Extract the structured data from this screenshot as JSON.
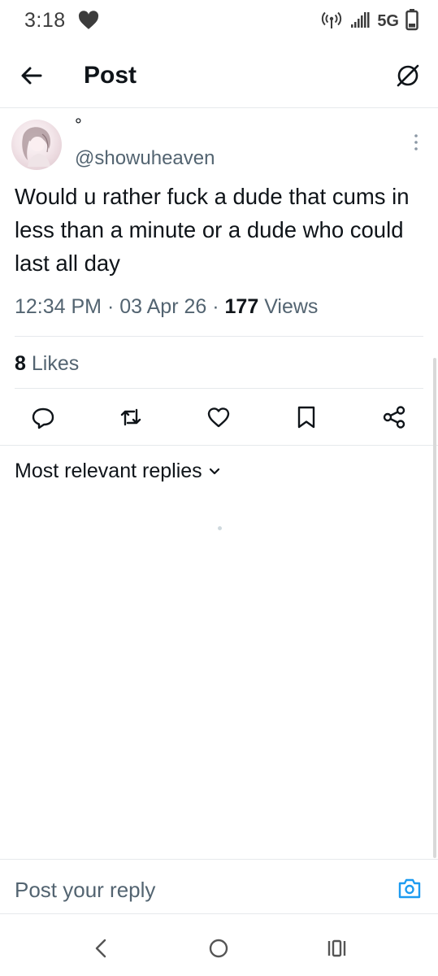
{
  "status_bar": {
    "time": "3:18",
    "network": "5G",
    "icons": [
      "heart-icon",
      "hotspot-icon",
      "signal-icon",
      "battery-icon"
    ]
  },
  "header": {
    "title": "Post",
    "back_icon": "arrow-left-icon",
    "grok_icon": "grok-icon"
  },
  "post": {
    "display_name": "°",
    "handle": "@showuheaven",
    "text": "Would u rather fuck a dude that cums in less than a minute or a dude who could last all day",
    "time": "12:34 PM",
    "date": "03 Apr 26",
    "separator": "·",
    "views_count": "177",
    "views_label": "Views",
    "likes_count": "8",
    "likes_label": "Likes"
  },
  "actions": [
    "reply-icon",
    "repost-icon",
    "like-icon",
    "bookmark-icon",
    "share-icon"
  ],
  "replies": {
    "filter_label": "Most relevant replies"
  },
  "reply_bar": {
    "placeholder": "Post your reply"
  },
  "nav_bar": [
    "back-nav-icon",
    "home-nav-icon",
    "recents-nav-icon"
  ],
  "colors": {
    "text_primary": "#0f1419",
    "text_secondary": "#536471",
    "accent": "#1d9bf0",
    "divider": "#e6e9ec"
  }
}
